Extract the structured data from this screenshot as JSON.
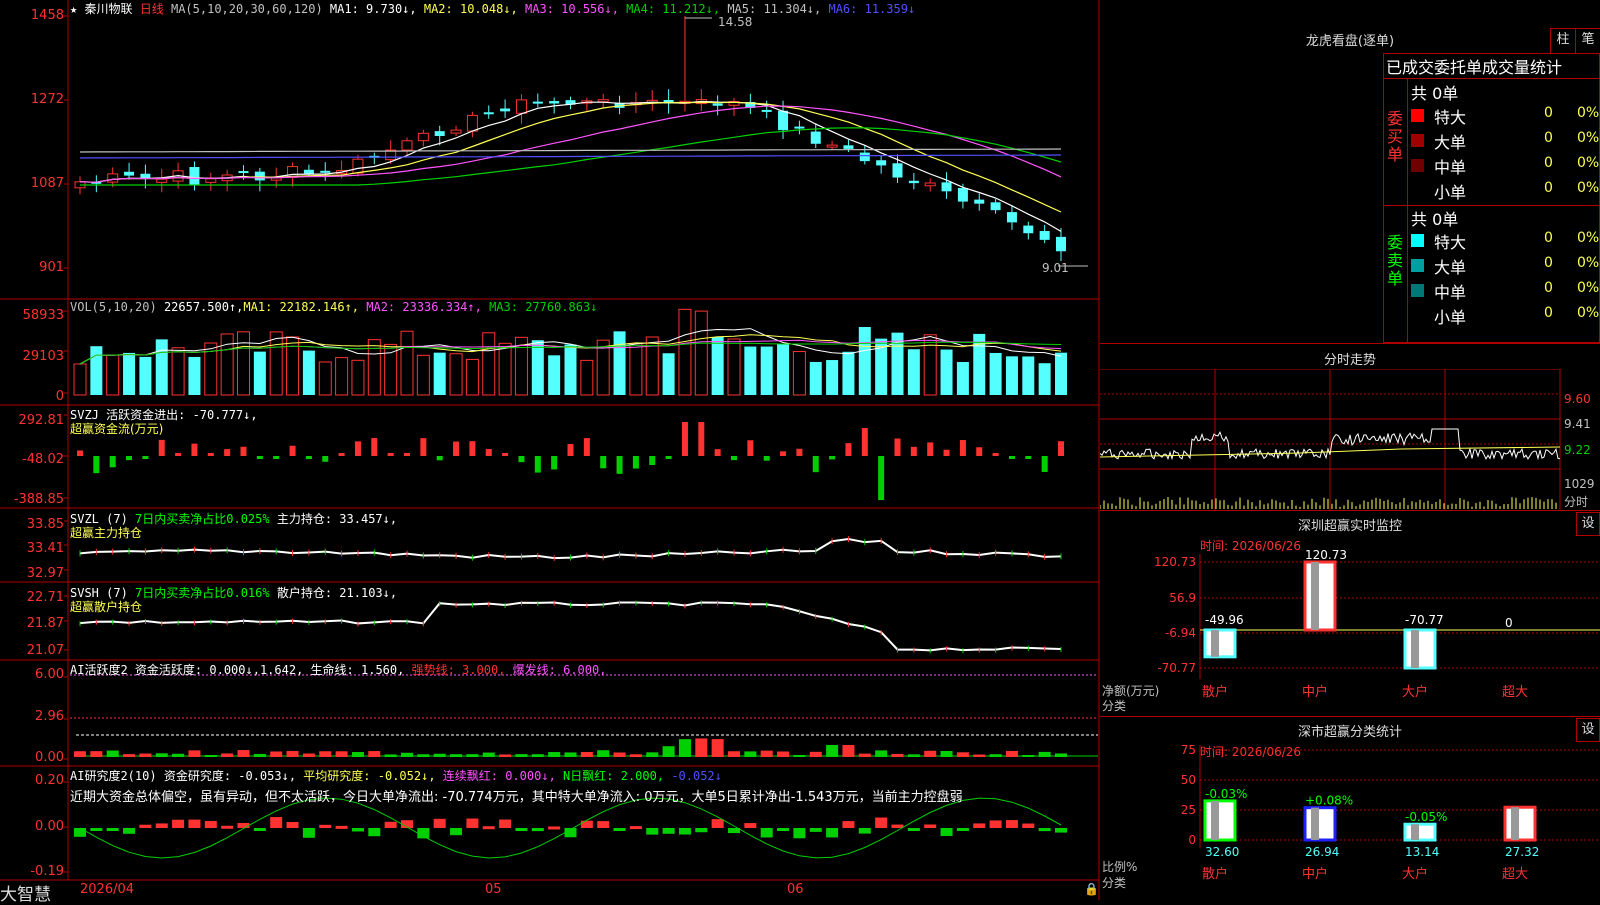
{
  "colors": {
    "up": "#ff3232",
    "down": "#54ffff",
    "frame": "#b00000",
    "yellow": "#ffff54",
    "magenta": "#ff54ff",
    "green": "#00d000",
    "white": "#ffffff",
    "blue": "#5050ff"
  },
  "main": {
    "star": "★",
    "stock_name": "秦川物联",
    "period": "日线",
    "ma_title": "MA(5,10,20,30,60,120)",
    "ma1": "MA1: 9.730↓,",
    "ma2": "MA2: 10.048↓,",
    "ma3": "MA3: 10.556↓,",
    "ma4": "MA4: 11.212↓,",
    "ma5": "MA5: 11.304↓,",
    "ma6": "MA6: 11.359↓",
    "price_axis": [
      "1458",
      "1272",
      "1087",
      "901"
    ],
    "high_label": "14.58",
    "low_label": "9.01"
  },
  "vol": {
    "title": "VOL(5,10,20)",
    "value": "22657.500↑,",
    "ma1": "MA1: 22182.146↑,",
    "ma2": "MA2: 23336.334↑,",
    "ma3": "MA3: 27760.863↓",
    "axis": [
      "58933",
      "29103",
      "0"
    ]
  },
  "svzj": {
    "title": "SVZJ  活跃资金进出: -70.777↓,",
    "subtitle": "超赢资金流(万元)",
    "axis": [
      "292.81",
      "-48.02",
      "-388.85"
    ]
  },
  "svzl": {
    "title": "SVZL (7)",
    "ratio": "7日内买卖净占比0.025%",
    "hold": "主力持仓: 33.457↓,",
    "subtitle": "超赢主力持仓",
    "axis": [
      "33.85",
      "33.41",
      "32.97"
    ]
  },
  "svsh": {
    "title": "SVSH (7)",
    "ratio": "7日内买卖净占比0.016%",
    "hold": "散户持仓: 21.103↓,",
    "subtitle": "超赢散户持仓",
    "axis": [
      "22.71",
      "21.87",
      "21.07"
    ]
  },
  "ai1": {
    "title": "AI活跃度2",
    "v1": "资金活跃度: 0.000↓,",
    "v2": "1.642,",
    "v3": "生命线: 1.560,",
    "v4": "强势线: 3.000,",
    "v5": "爆发线: 6.000,",
    "axis": [
      "6.00",
      "2.96",
      "0.00"
    ]
  },
  "ai2": {
    "title": "AI研究度2(10)",
    "v1": "资金研究度: -0.053↓,",
    "v2": "平均研究度: -0.052↓,",
    "v3": "连续飘红: 0.000↓,",
    "v4": "N日飘红: 2.000,",
    "v5": "-0.052↓",
    "text": "近期大资金总体偏空，虽有异动，但不太活跃，今日大单净流出: -70.774万元，其中特大单净流入: 0万元，大单5日累计净出-1.543万元，当前主力控盘弱",
    "axis": [
      "0.20",
      "0.00",
      "-0.19"
    ]
  },
  "xaxis": {
    "brand": "大智慧",
    "d1": "2026/04",
    "d2": "05",
    "d3": "06"
  },
  "dragon": {
    "title": "龙虎看盘(逐单)",
    "btn_zhu": "柱",
    "btn_bi": "笔",
    "headers": "已成交委托单成交量统计",
    "buy_label": [
      "委",
      "买",
      "单"
    ],
    "sell_label": [
      "委",
      "卖",
      "单"
    ],
    "buy_total": "共 0单",
    "sell_total": "共 0单",
    "buy_rows": [
      {
        "name": "特大",
        "n": "0",
        "p": "0%",
        "c": "#ff0000"
      },
      {
        "name": "大单",
        "n": "0",
        "p": "0%",
        "c": "#a00000"
      },
      {
        "name": "中单",
        "n": "0",
        "p": "0%",
        "c": "#700000"
      },
      {
        "name": "小单",
        "n": "0",
        "p": "0%",
        "c": "#000000"
      }
    ],
    "sell_rows": [
      {
        "name": "特大",
        "n": "0",
        "p": "0%",
        "c": "#00ffff"
      },
      {
        "name": "大单",
        "n": "0",
        "p": "0%",
        "c": "#00a0a0"
      },
      {
        "name": "中单",
        "n": "0",
        "p": "0%",
        "c": "#007878"
      },
      {
        "name": "小单",
        "n": "0",
        "p": "0%",
        "c": "#000000"
      }
    ]
  },
  "minute": {
    "title": "分时走势",
    "axis": [
      "9.60",
      "9.41",
      "9.22"
    ],
    "vol_top": "1029",
    "vol_label": "分时"
  },
  "monitor": {
    "title": "深圳超赢实时监控",
    "btn": "设",
    "date": "时间: 2026/06/26",
    "axis": [
      "120.73",
      "56.9",
      "-6.94",
      "-70.77"
    ],
    "top": "120.73",
    "labels": [
      "-49.96",
      "",
      "-70.77",
      "0"
    ],
    "ylabel1": "净额(万元)",
    "ylabel2": "分类",
    "cats": [
      "散户",
      "中户",
      "大户",
      "超大"
    ],
    "values": [
      -49.96,
      120.73,
      -70.77,
      0
    ]
  },
  "classify": {
    "title": "深市超赢分类统计",
    "btn": "设",
    "date": "时间: 2026/06/26",
    "axis": [
      "75",
      "50",
      "25",
      "0"
    ],
    "top_labels": [
      "-0.03%",
      "+0.08%",
      "-0.05%",
      ""
    ],
    "bottom_labels": [
      "32.60",
      "26.94",
      "13.14",
      "27.32"
    ],
    "ylabel1": "比例%",
    "ylabel2": "分类",
    "cats": [
      "散户",
      "中户",
      "大户",
      "超大"
    ],
    "values": [
      32.6,
      26.94,
      13.14,
      27.32
    ]
  }
}
